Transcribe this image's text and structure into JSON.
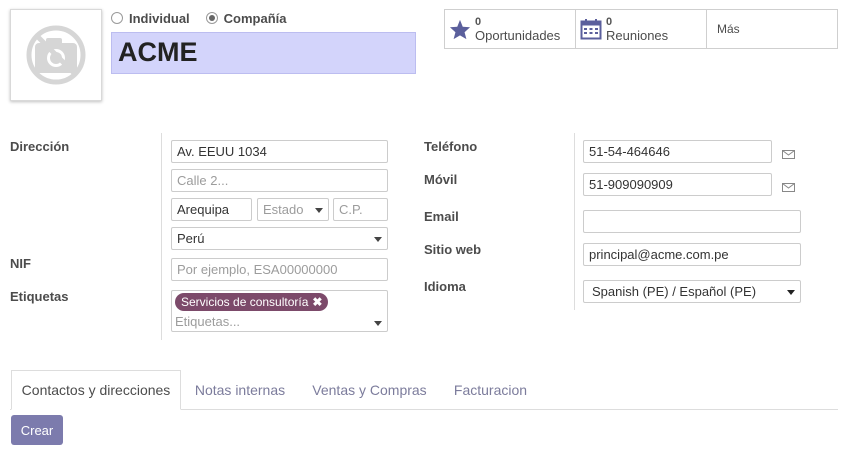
{
  "company_type": {
    "individual_label": "Individual",
    "company_label": "Compañía",
    "selected": "company"
  },
  "name": "ACME",
  "smart_buttons": {
    "opportunities": {
      "count": "0",
      "label": "Oportunidades",
      "icon": "star-icon"
    },
    "meetings": {
      "count": "0",
      "label": "Reuniones",
      "icon": "calendar-icon"
    },
    "more_label": "Más"
  },
  "labels": {
    "address": "Dirección",
    "vat": "NIF",
    "tags": "Etiquetas",
    "phone": "Teléfono",
    "mobile": "Móvil",
    "email": "Email",
    "website": "Sitio web",
    "language": "Idioma"
  },
  "address": {
    "street": "Av. EEUU 1034",
    "street2_placeholder": "Calle 2...",
    "city": "Arequipa",
    "state_placeholder": "Estado",
    "zip_placeholder": "C.P.",
    "country": "Perú"
  },
  "vat_placeholder": "Por ejemplo, ESA00000000",
  "tags": {
    "items": [
      "Servicios de consultoría"
    ],
    "placeholder": "Etiquetas..."
  },
  "contact": {
    "phone": "51-54-464646",
    "mobile": "51-909090909",
    "email": "",
    "website": "principal@acme.com.pe",
    "language": "Spanish (PE) / Español (PE)"
  },
  "tabs": [
    "Contactos y direcciones",
    "Notas internas",
    "Ventas y Compras",
    "Facturacion"
  ],
  "active_tab": 0,
  "create_button": "Crear",
  "colors": {
    "accent": "#7c7bad",
    "name_bg": "#d3d4fb",
    "tag_bg": "#7c4a6a"
  }
}
